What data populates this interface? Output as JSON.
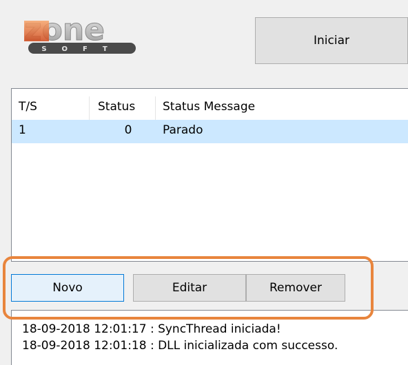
{
  "logo": {
    "main_text": "zone",
    "sub_text": "SOFT"
  },
  "toolbar": {
    "start_label": "Iniciar"
  },
  "table": {
    "columns": [
      "T/S",
      "Status",
      "Status Message"
    ],
    "rows": [
      {
        "ts": "1",
        "status": "0",
        "message": "Parado"
      }
    ]
  },
  "buttons": {
    "new_label": "Novo",
    "edit_label": "Editar",
    "remove_label": "Remover"
  },
  "log": {
    "lines": [
      "18-09-2018 12:01:17 : SyncThread iniciada!",
      "18-09-2018 12:01:18 : DLL inicializada com successo."
    ]
  },
  "colors": {
    "highlight": "#e8853d",
    "selection": "#cce8ff",
    "button_focus": "#0078d7"
  }
}
